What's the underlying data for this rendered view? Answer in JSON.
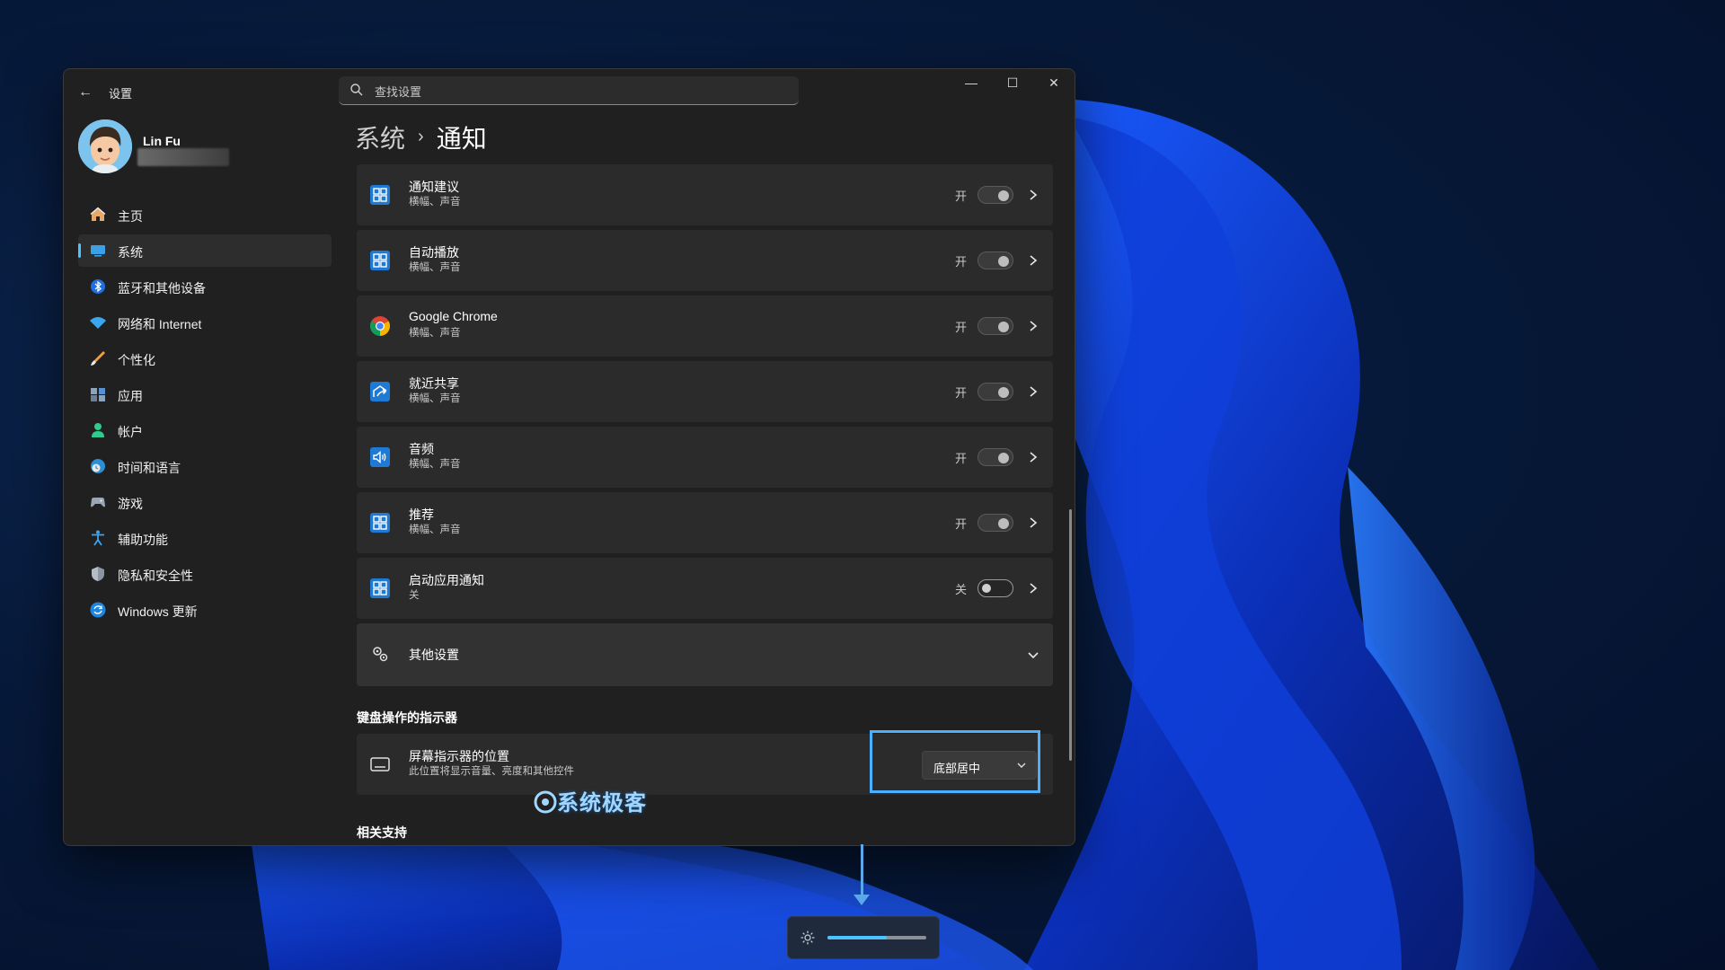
{
  "window": {
    "app_title": "设置",
    "back_glyph": "←",
    "minimize_glyph": "—",
    "maximize_glyph": "☐",
    "close_glyph": "✕"
  },
  "search": {
    "placeholder": "查找设置"
  },
  "profile": {
    "name": "Lin Fu"
  },
  "sidebar": {
    "items": [
      {
        "label": "主页",
        "icon": "home-icon",
        "active": false
      },
      {
        "label": "系统",
        "icon": "system-icon",
        "active": true
      },
      {
        "label": "蓝牙和其他设备",
        "icon": "bluetooth-icon",
        "active": false
      },
      {
        "label": "网络和 Internet",
        "icon": "network-icon",
        "active": false
      },
      {
        "label": "个性化",
        "icon": "brush-icon",
        "active": false
      },
      {
        "label": "应用",
        "icon": "apps-icon",
        "active": false
      },
      {
        "label": "帐户",
        "icon": "account-icon",
        "active": false
      },
      {
        "label": "时间和语言",
        "icon": "clock-globe-icon",
        "active": false
      },
      {
        "label": "游戏",
        "icon": "gamepad-icon",
        "active": false
      },
      {
        "label": "辅助功能",
        "icon": "accessibility-icon",
        "active": false
      },
      {
        "label": "隐私和安全性",
        "icon": "shield-icon",
        "active": false
      },
      {
        "label": "Windows 更新",
        "icon": "update-icon",
        "active": false
      }
    ]
  },
  "breadcrumb": {
    "parent": "系统",
    "separator": "›",
    "current": "通知"
  },
  "notification_rows": [
    {
      "title": "通知建议",
      "subtitle": "横幅、声音",
      "state": "开",
      "on": true,
      "icon": "app-tile-icon"
    },
    {
      "title": "自动播放",
      "subtitle": "横幅、声音",
      "state": "开",
      "on": true,
      "icon": "app-tile-icon"
    },
    {
      "title": "Google Chrome",
      "subtitle": "横幅、声音",
      "state": "开",
      "on": true,
      "icon": "chrome-icon"
    },
    {
      "title": "就近共享",
      "subtitle": "横幅、声音",
      "state": "开",
      "on": true,
      "icon": "share-icon"
    },
    {
      "title": "音频",
      "subtitle": "横幅、声音",
      "state": "开",
      "on": true,
      "icon": "speaker-icon"
    },
    {
      "title": "推荐",
      "subtitle": "横幅、声音",
      "state": "开",
      "on": true,
      "icon": "app-tile-icon"
    },
    {
      "title": "启动应用通知",
      "subtitle": "关",
      "state": "关",
      "on": false,
      "icon": "app-tile-icon"
    }
  ],
  "other_settings": {
    "title": "其他设置",
    "icon": "gears-icon"
  },
  "keyboard_section": {
    "title": "键盘操作的指示器",
    "row_title": "屏幕指示器的位置",
    "row_subtitle": "此位置将显示音量、亮度和其他控件",
    "dropdown_value": "底部居中"
  },
  "related_support": {
    "title": "相关支持"
  },
  "watermark": {
    "text": "系统极客"
  },
  "flyout": {
    "brightness_level": 0.6
  },
  "colors": {
    "accent": "#4cc2ff",
    "highlight_border": "#4ab0ff",
    "window_bg": "#202020",
    "card_bg": "#2b2b2b"
  }
}
